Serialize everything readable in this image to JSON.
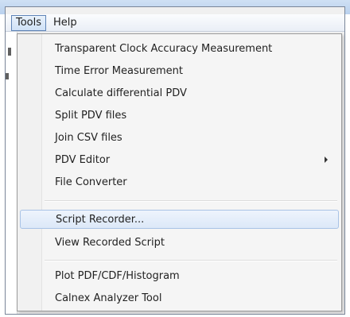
{
  "menubar": {
    "tools_label": "Tools",
    "help_label": "Help"
  },
  "tools_menu": {
    "items": [
      {
        "label": "Transparent Clock Accuracy Measurement"
      },
      {
        "label": "Time Error Measurement"
      },
      {
        "label": "Calculate differential PDV"
      },
      {
        "label": "Split PDV files"
      },
      {
        "label": "Join CSV files"
      },
      {
        "label": "PDV Editor",
        "has_submenu": true
      },
      {
        "label": "File Converter"
      },
      {
        "label": "Script Recorder...",
        "highlighted": true
      },
      {
        "label": "View Recorded Script"
      },
      {
        "label": "Plot PDF/CDF/Histogram"
      },
      {
        "label": "Calnex Analyzer Tool"
      }
    ]
  },
  "colors": {
    "highlight_border": "#a9c3e6",
    "menu_background": "#f5f5f5"
  }
}
